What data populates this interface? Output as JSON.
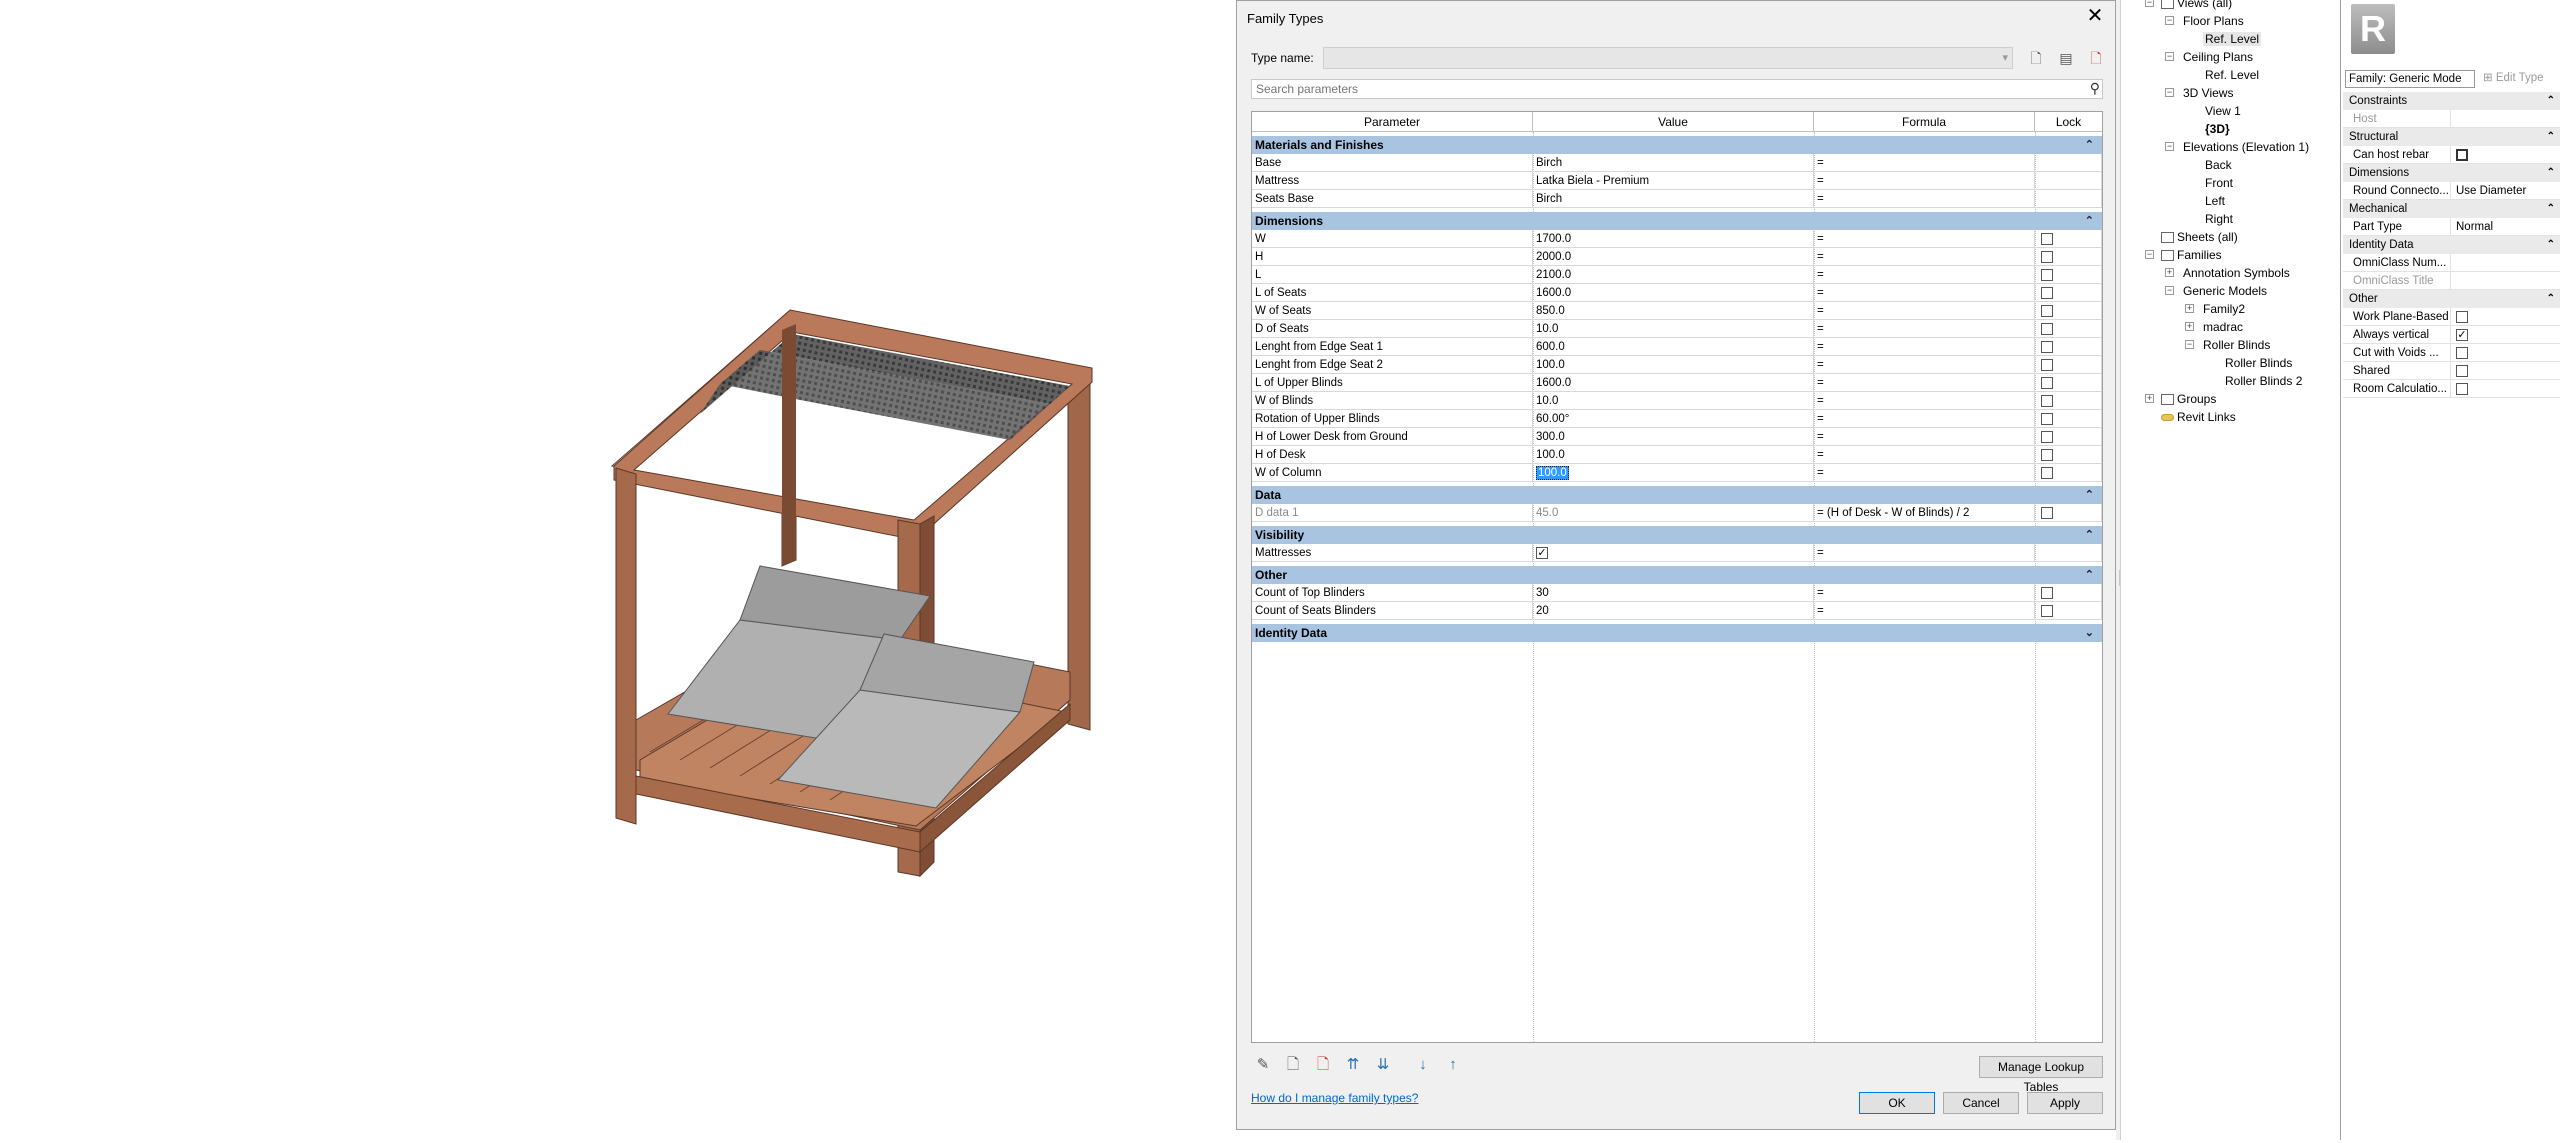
{
  "dialog": {
    "title": "Family Types",
    "close_glyph": "✕",
    "type_name_label": "Type name:",
    "type_name_value": "",
    "search_placeholder": "Search parameters",
    "headers": {
      "parameter": "Parameter",
      "value": "Value",
      "formula": "Formula",
      "lock": "Lock"
    },
    "groups": {
      "materials": "Materials and Finishes",
      "dimensions": "Dimensions",
      "data": "Data",
      "visibility": "Visibility",
      "other": "Other",
      "identity": "Identity Data"
    },
    "materials": [
      {
        "name": "Base",
        "value": "Birch",
        "formula": "="
      },
      {
        "name": "Mattress",
        "value": "Latka Biela - Premium",
        "formula": "="
      },
      {
        "name": "Seats Base",
        "value": "Birch",
        "formula": "="
      }
    ],
    "dimensions": [
      {
        "name": "W",
        "value": "1700.0",
        "formula": "="
      },
      {
        "name": "H",
        "value": "2000.0",
        "formula": "="
      },
      {
        "name": "L",
        "value": "2100.0",
        "formula": "="
      },
      {
        "name": "L of Seats",
        "value": "1600.0",
        "formula": "="
      },
      {
        "name": "W of Seats",
        "value": "850.0",
        "formula": "="
      },
      {
        "name": "D of Seats",
        "value": "10.0",
        "formula": "="
      },
      {
        "name": "Lenght from Edge Seat 1",
        "value": "600.0",
        "formula": "="
      },
      {
        "name": "Lenght from Edge Seat 2",
        "value": "100.0",
        "formula": "="
      },
      {
        "name": "L of Upper Blinds",
        "value": "1600.0",
        "formula": "="
      },
      {
        "name": "W of Blinds",
        "value": "10.0",
        "formula": "="
      },
      {
        "name": "Rotation of Upper Blinds",
        "value": "60.00°",
        "formula": "="
      },
      {
        "name": "H of Lower Desk from Ground",
        "value": "300.0",
        "formula": "="
      },
      {
        "name": "H of Desk",
        "value": "100.0",
        "formula": "="
      },
      {
        "name": "W of Column",
        "value": "100.0",
        "formula": "="
      }
    ],
    "data_rows": [
      {
        "name": "D data 1",
        "value": "45.0",
        "formula": "= (H of Desk - W of Blinds) / 2"
      }
    ],
    "visibility": [
      {
        "name": "Mattresses",
        "formula": "=",
        "checked": true
      }
    ],
    "other": [
      {
        "name": "Count of Top Blinders",
        "value": "30",
        "formula": "="
      },
      {
        "name": "Count of Seats Blinders",
        "value": "20",
        "formula": "="
      }
    ],
    "manage_lookup": "Manage Lookup Tables",
    "help_link": "How do I manage family types?",
    "ok": "OK",
    "cancel": "Cancel",
    "apply": "Apply"
  },
  "tree": {
    "views_all": "Views (all)",
    "floor_plans": "Floor Plans",
    "ref_level_1": "Ref. Level",
    "ceiling_plans": "Ceiling Plans",
    "ref_level_2": "Ref. Level",
    "views_3d": "3D Views",
    "view1": "View 1",
    "view_3d": "{3D}",
    "elevations": "Elevations (Elevation 1)",
    "back": "Back",
    "front": "Front",
    "left": "Left",
    "right": "Right",
    "sheets": "Sheets (all)",
    "families": "Families",
    "annotation_symbols": "Annotation Symbols",
    "generic_models": "Generic Models",
    "family2": "Family2",
    "madrac": "madrac",
    "roller_blinds": "Roller Blinds",
    "roller_blinds_child1": "Roller Blinds",
    "roller_blinds_child2": "Roller Blinds 2",
    "groups": "Groups",
    "revit_links": "Revit Links"
  },
  "props": {
    "logo_letter": "R",
    "family_selector": "Family: Generic Mode",
    "edit_type": "Edit Type",
    "constraints": "Constraints",
    "host": "Host",
    "structural": "Structural",
    "can_host_rebar": "Can host rebar",
    "dimensions": "Dimensions",
    "round_connector": "Round Connecto...",
    "round_connector_value": "Use Diameter",
    "mechanical": "Mechanical",
    "part_type": "Part Type",
    "part_type_value": "Normal",
    "identity_data": "Identity Data",
    "omniclass_num": "OmniClass Num...",
    "omniclass_title": "OmniClass Title",
    "other": "Other",
    "work_plane_based": "Work Plane-Based",
    "always_vertical": "Always vertical",
    "cut_with_voids": "Cut with Voids ...",
    "shared": "Shared",
    "room_calculation": "Room Calculatio..."
  },
  "colors": {
    "group_header": "#a9c4e1",
    "wood": "#a0674a",
    "mattress": "#b5b5b5",
    "link": "#0066cc"
  }
}
